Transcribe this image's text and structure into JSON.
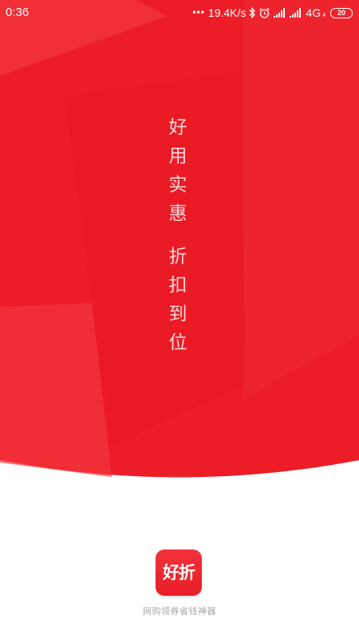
{
  "colors": {
    "brand_red": "#ec1d27",
    "background": "#ffffff",
    "tagline_gray": "#a7a7a7"
  },
  "status_bar": {
    "time": "0:36",
    "dots": "•••",
    "network_speed": "19.4K/s",
    "icons": [
      "bluetooth-icon",
      "alarm-icon",
      "signal-icon",
      "signal-icon"
    ],
    "network_type": "4G",
    "network_sub": "4",
    "battery": "20"
  },
  "slogan": {
    "line1": [
      "好",
      "用",
      "实",
      "惠"
    ],
    "line2": [
      "折",
      "扣",
      "到",
      "位"
    ]
  },
  "app": {
    "logo_text": "好折",
    "tagline": "网购领券省钱神器"
  }
}
